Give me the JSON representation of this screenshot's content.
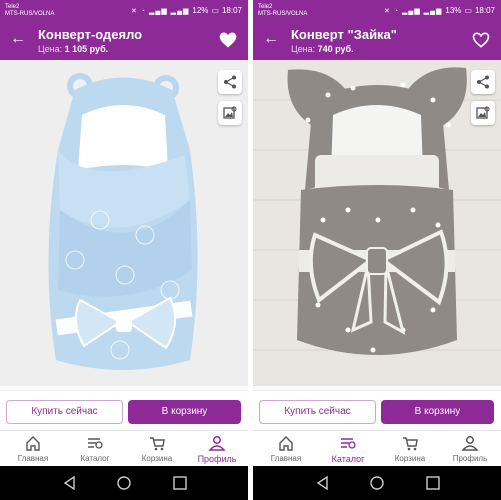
{
  "screens": [
    {
      "status": {
        "carrier_line1": "Tele2",
        "carrier_line2": "MTS-RUS/VOLNA",
        "battery": "12%",
        "time": "18:07"
      },
      "header": {
        "title": "Конверт-одеяло",
        "price_label": "Цена:",
        "price_value": "1 105 руб."
      },
      "actions": {
        "buy_now": "Купить сейчас",
        "add_to_cart": "В корзину"
      },
      "nav": [
        {
          "label": "Главная",
          "icon": "home-icon"
        },
        {
          "label": "Каталог",
          "icon": "catalog-icon"
        },
        {
          "label": "Корзина",
          "icon": "cart-icon"
        },
        {
          "label": "Профиль",
          "icon": "profile-icon",
          "active": true
        }
      ]
    },
    {
      "status": {
        "carrier_line1": "Tele2",
        "carrier_line2": "MTS-RUS/VOLNA",
        "battery": "13%",
        "time": "18:07"
      },
      "header": {
        "title": "Конверт \"Зайка\"",
        "price_label": "Цена:",
        "price_value": "740 руб."
      },
      "actions": {
        "buy_now": "Купить сейчас",
        "add_to_cart": "В корзину"
      },
      "nav": [
        {
          "label": "Главная",
          "icon": "home-icon"
        },
        {
          "label": "Каталог",
          "icon": "catalog-icon",
          "active": true
        },
        {
          "label": "Корзина",
          "icon": "cart-icon"
        },
        {
          "label": "Профиль",
          "icon": "profile-icon"
        }
      ]
    }
  ],
  "colors": {
    "accent": "#8d2a98",
    "swaddle_blue": "#bcd9ef",
    "swaddle_grey": "#8f8a85"
  }
}
